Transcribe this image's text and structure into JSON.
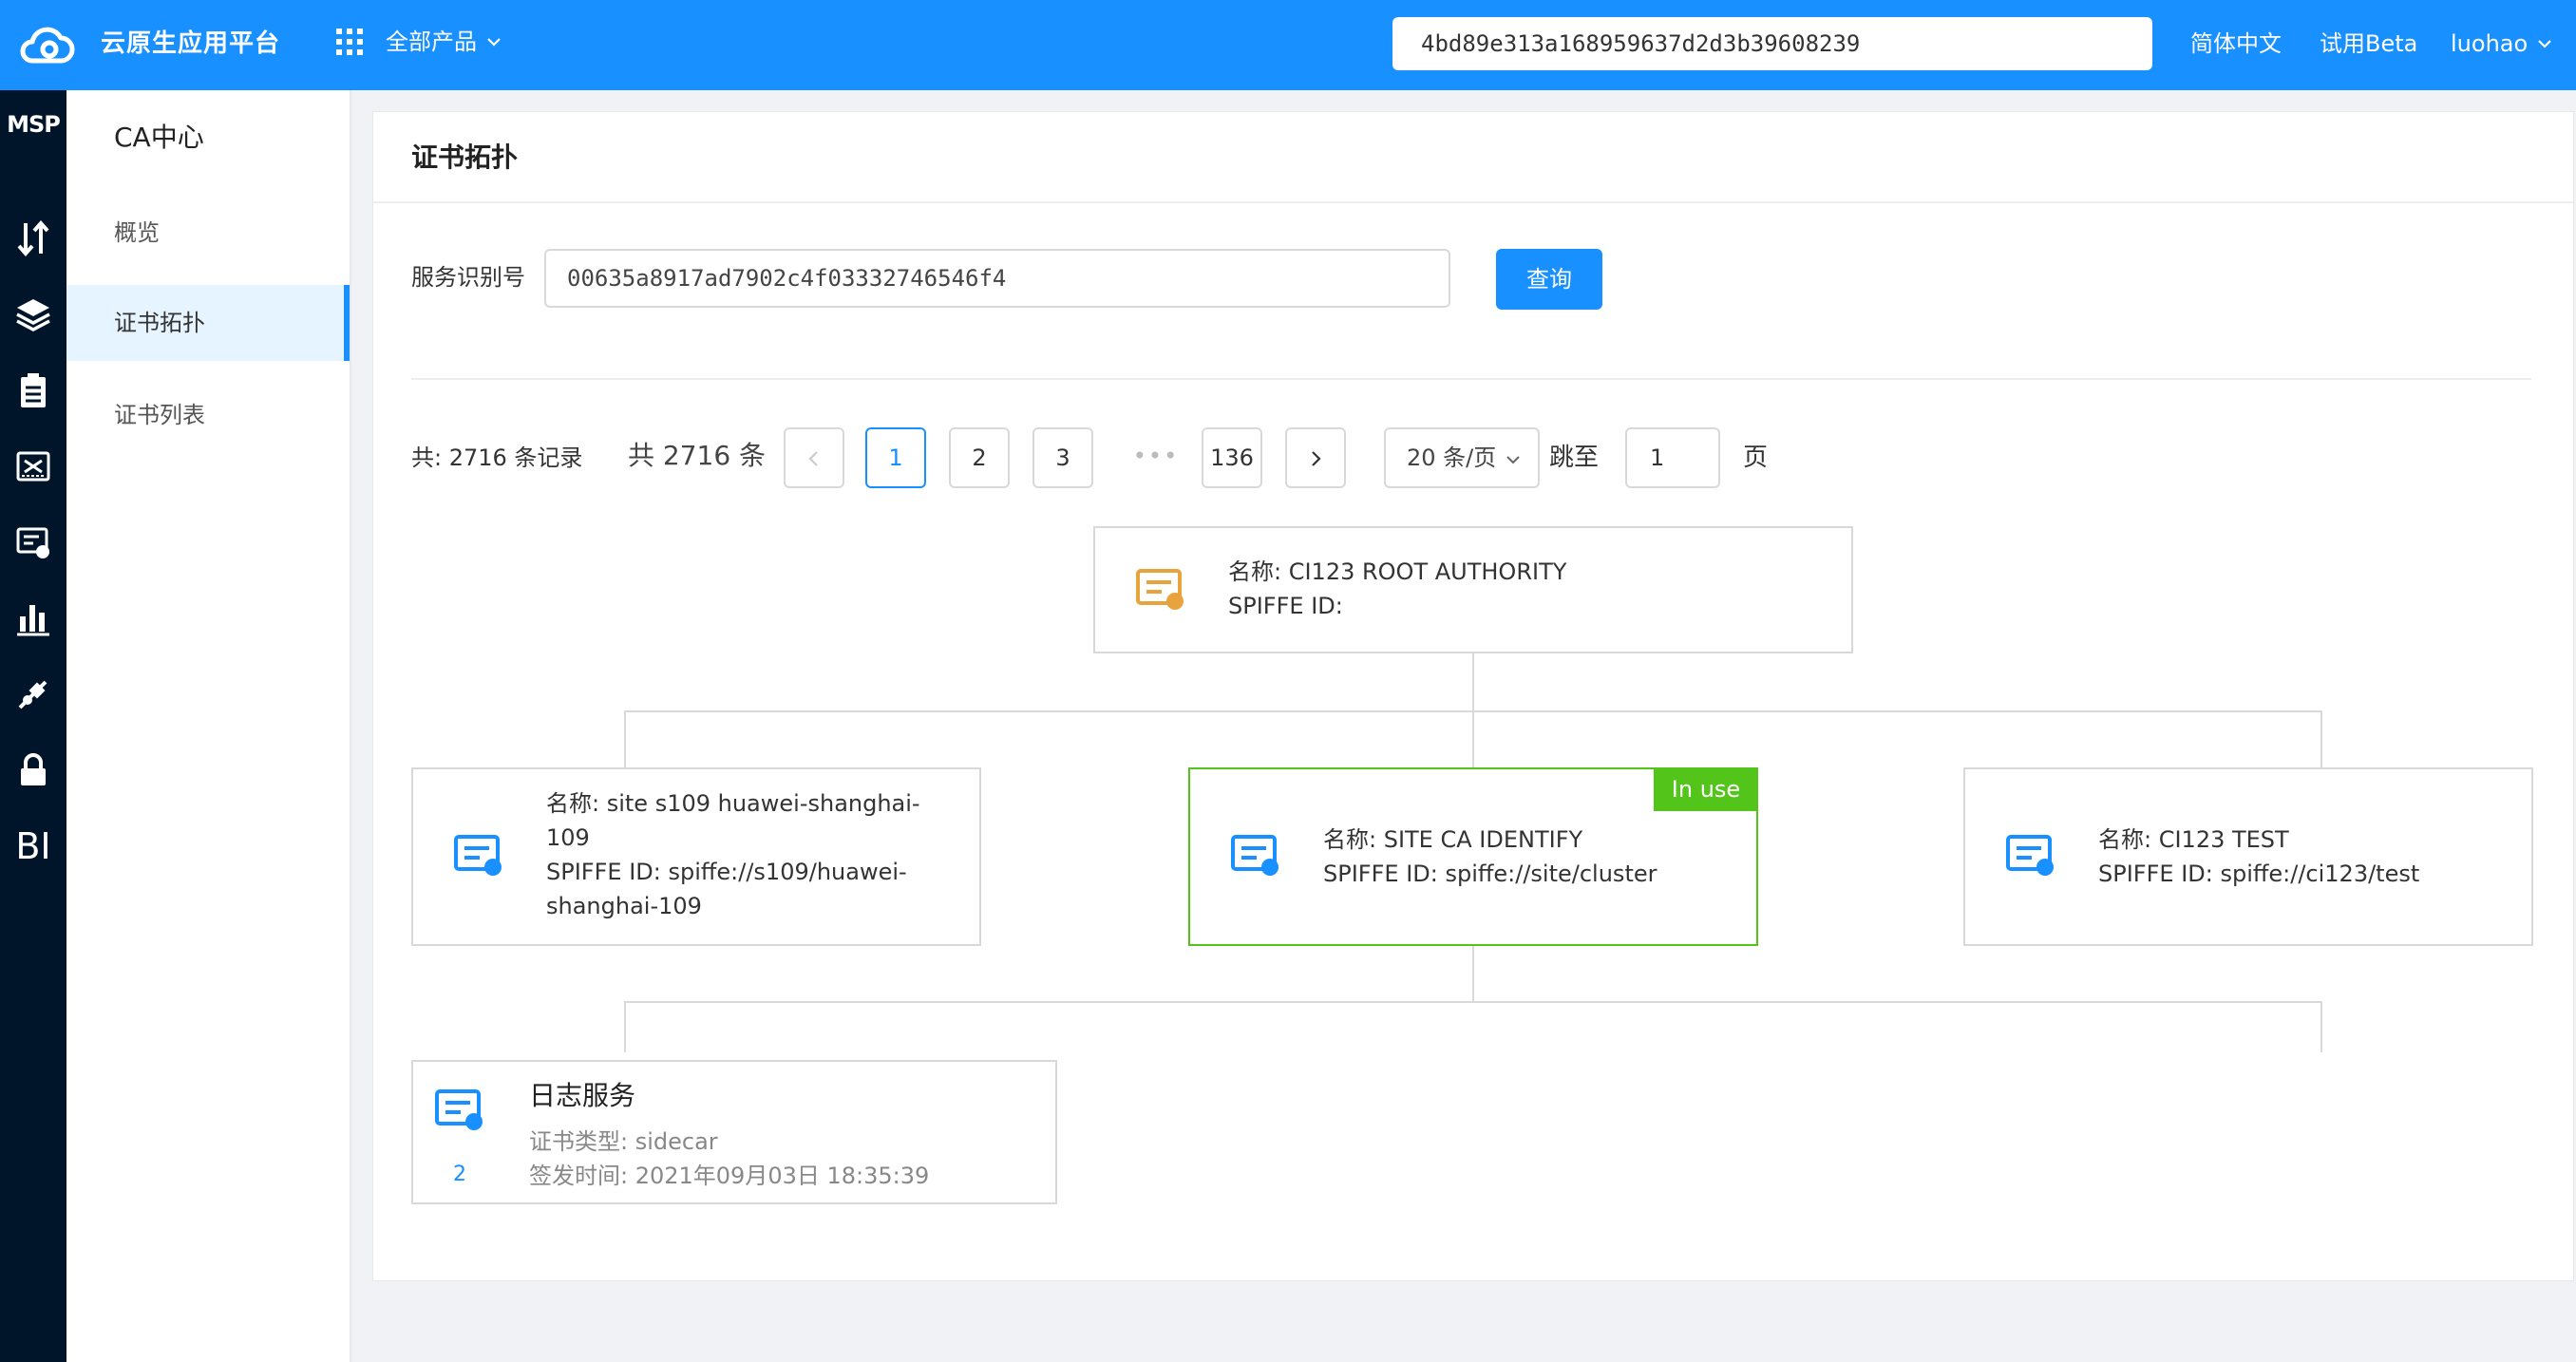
{
  "header": {
    "app_title": "云原生应用平台",
    "all_products": "全部产品",
    "search_value": "4bd89e313a168959637d2d3b39608239",
    "language": "简体中文",
    "beta": "试用Beta",
    "user": "luohao"
  },
  "rail": {
    "title": "MSP",
    "icons": [
      "transfer-icon",
      "layers-icon",
      "clipboard-icon",
      "gateway-icon",
      "certificate-monitor-icon",
      "bar-chart-icon",
      "plug-icon",
      "lock-icon",
      "bi-icon"
    ],
    "bi_label": "BI"
  },
  "submenu": {
    "title": "CA中心",
    "items": [
      {
        "label": "概览"
      },
      {
        "label": "证书拓扑",
        "active": true
      },
      {
        "label": "证书列表"
      }
    ]
  },
  "page": {
    "title": "证书拓扑",
    "form_label": "服务识别号",
    "service_id": "00635a8917ad7902c4f03332746546f4",
    "query_button": "查询"
  },
  "pagination": {
    "total_records": "共: 2716 条记录",
    "total_count": "共 2716 条",
    "pages": [
      "1",
      "2",
      "3",
      "136"
    ],
    "current": "1",
    "dots": "•••",
    "page_size": "20 条/页",
    "jump_label": "跳至",
    "jump_value": "1",
    "page_unit": "页"
  },
  "tree": {
    "root": {
      "name_line": "名称: CI123 ROOT AUTHORITY",
      "spiffe_line": "SPIFFE ID:"
    },
    "children": [
      {
        "name_line1": "名称: site s109 huawei-shanghai-",
        "name_line2": "109",
        "spiffe_line1": "SPIFFE ID: spiffe://s109/huawei-",
        "spiffe_line2": "shanghai-109"
      },
      {
        "name_line": "名称: SITE CA IDENTIFY",
        "spiffe_line": "SPIFFE ID: spiffe://site/cluster",
        "tag": "In use"
      },
      {
        "name_line": "名称: CI123 TEST",
        "spiffe_line": "SPIFFE ID: spiffe://ci123/test"
      }
    ],
    "leaf": {
      "title": "日志服务",
      "type_line": "证书类型: sidecar",
      "time_line": "签发时间: 2021年09月03日 18:35:39",
      "count": "2"
    }
  },
  "colors": {
    "primary": "#1890ff",
    "rail": "#001529",
    "in_use": "#52c41a",
    "root_icon": "#e8a33d"
  }
}
